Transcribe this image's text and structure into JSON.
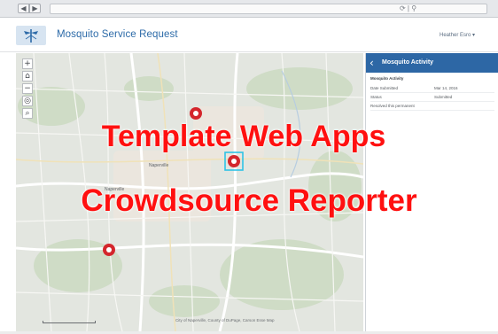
{
  "browser": {
    "back_label": "◀",
    "forward_label": "▶",
    "address_icons": "⟳ | ⚲"
  },
  "app": {
    "title": "Mosquito Service Request",
    "user_menu": "Heather Esro ▾",
    "logo_icon": "mosquito-logo-icon",
    "brand_color": "#2c6aa8"
  },
  "map": {
    "controls": [
      "+",
      "⌂",
      "−",
      "◎",
      "⌕"
    ],
    "attribution": "City of Naperville, County of DuPage, Carson Esse Map",
    "markers": [
      "mosquito-marker-icon",
      "mosquito-marker-icon",
      "mosquito-marker-icon"
    ]
  },
  "panel": {
    "title": "Mosquito Activity",
    "subtitle": "Mosquito Activity",
    "header_color": "#2d67a5",
    "rows": [
      {
        "key": "Date Submitted",
        "value": "Mar 14, 2016"
      },
      {
        "key": "Status",
        "value": "Submitted"
      },
      {
        "key": "Resolved this permanent",
        "value": ""
      }
    ]
  },
  "overlay": {
    "line1": "Template Web Apps",
    "line2": "Crowdsource Reporter",
    "color": "#ff1010"
  }
}
